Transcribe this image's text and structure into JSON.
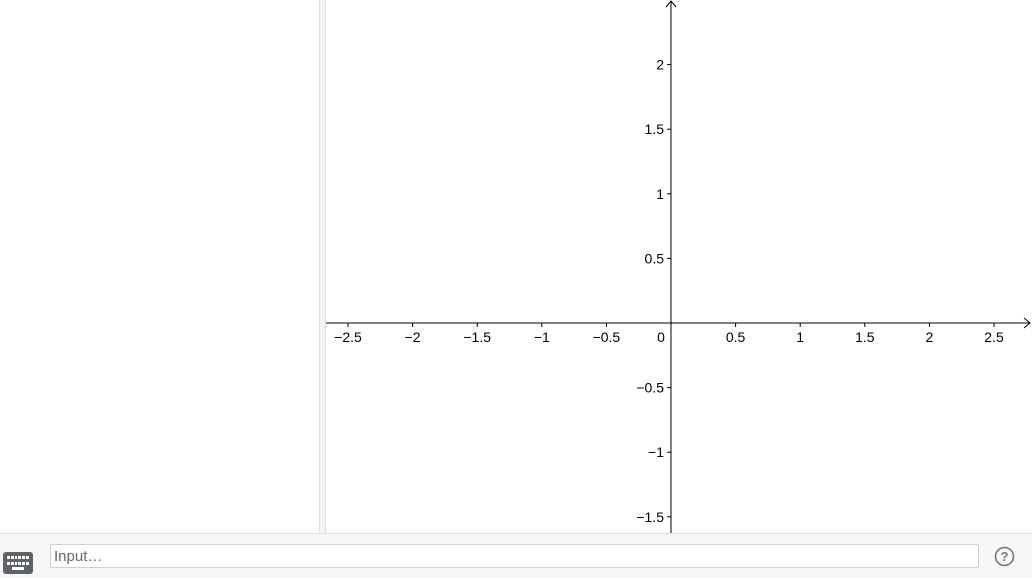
{
  "input_bar": {
    "placeholder": "Input…",
    "keyboard_icon": "keyboard-icon",
    "help_icon": "help-icon"
  },
  "graphics": {
    "x_axis": {
      "min": -2.6,
      "max": 2.8,
      "ticks": [
        -2.5,
        -2,
        -1.5,
        -1,
        -0.5,
        0.5,
        1,
        1.5,
        2,
        2.5
      ],
      "tick_labels": [
        "−2.5",
        "−2",
        "−1.5",
        "−1",
        "−0.5",
        "0.5",
        "1",
        "1.5",
        "2",
        "2.5"
      ]
    },
    "y_axis": {
      "min": -1.62,
      "max": 2.5,
      "ticks": [
        2,
        1.5,
        1,
        0.5,
        -0.5,
        -1,
        -1.5
      ],
      "tick_labels": [
        "2",
        "1.5",
        "1",
        "0.5",
        "−0.5",
        "−1",
        "−1.5"
      ]
    },
    "origin_label": "0",
    "axis_color": "#000000"
  },
  "colors": {
    "background": "#ffffff",
    "splitter": "#f4f4f4",
    "input_bar_background": "#f7f7f7",
    "keyboard_button": "#5f6368"
  }
}
